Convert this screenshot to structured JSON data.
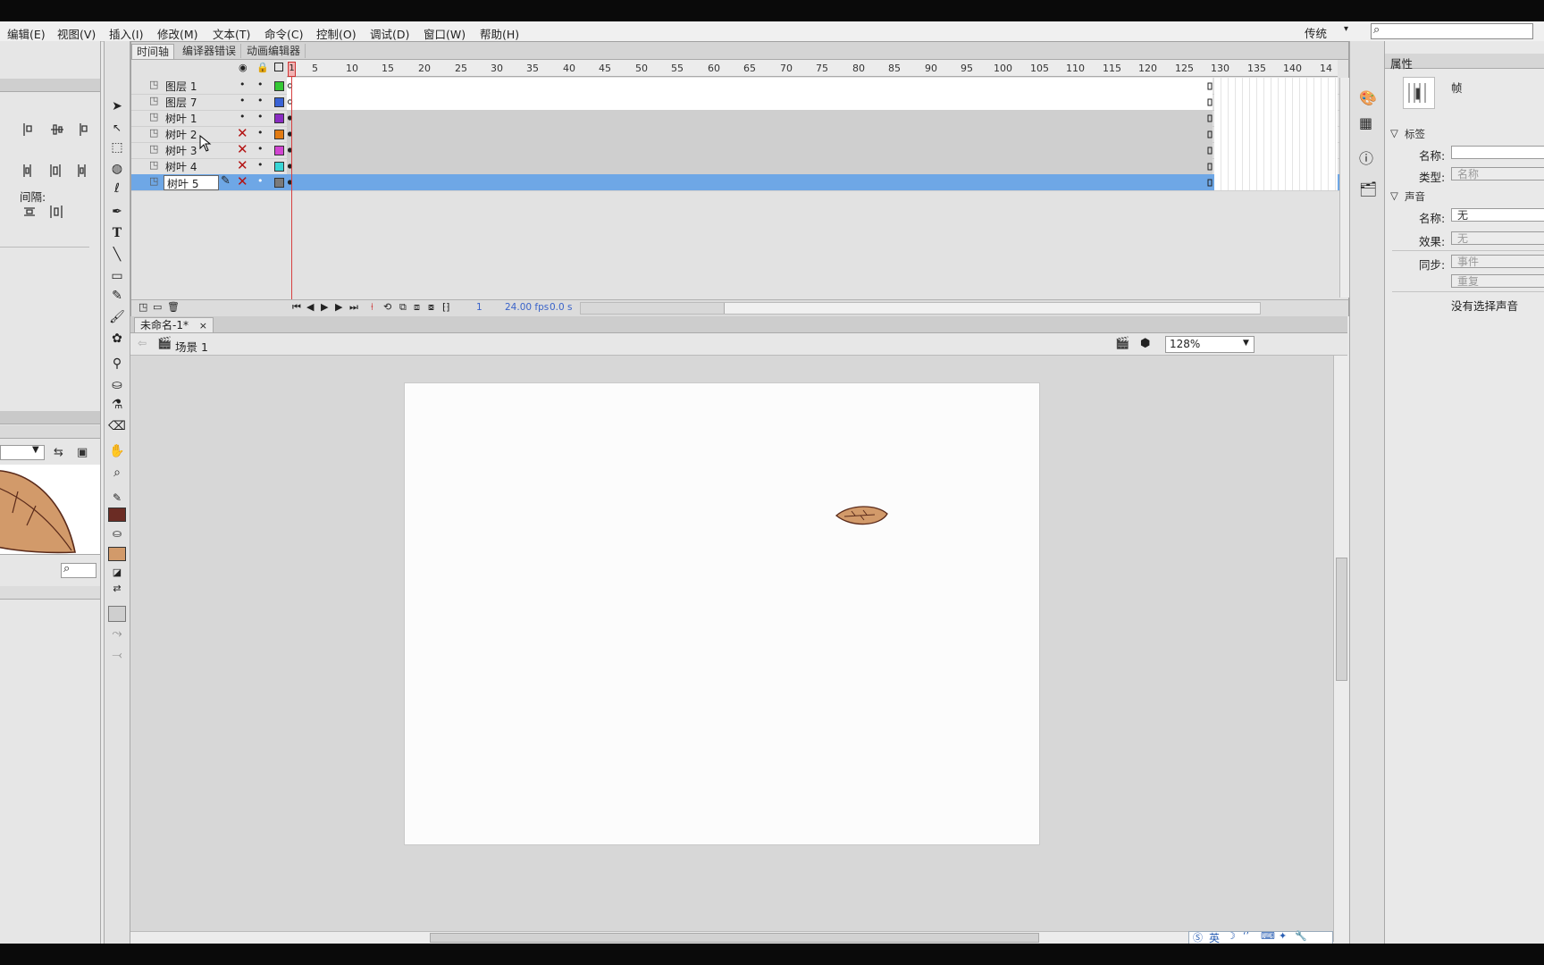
{
  "menu": [
    "编辑(E)",
    "视图(V)",
    "插入(I)",
    "修改(M)",
    "文本(T)",
    "命令(C)",
    "控制(O)",
    "调试(D)",
    "窗口(W)",
    "帮助(H)"
  ],
  "workspace": {
    "label": "传统",
    "caret": "▾"
  },
  "left_panel": {
    "spacing_label": "间隔:"
  },
  "timeline": {
    "tabs": [
      "时间轴",
      "编译器错误",
      "动画编辑器"
    ],
    "ruler": [
      "5",
      "10",
      "15",
      "20",
      "25",
      "30",
      "35",
      "40",
      "45",
      "50",
      "55",
      "60",
      "65",
      "70",
      "75",
      "80",
      "85",
      "90",
      "95",
      "100",
      "105",
      "110",
      "115",
      "120",
      "125",
      "130",
      "135",
      "140",
      "14"
    ],
    "playhead_frame": "1",
    "layers": [
      {
        "name": "图层 1",
        "color": "#35c935",
        "hidden": false,
        "selected": false
      },
      {
        "name": "图层 7",
        "color": "#3a63d6",
        "hidden": false,
        "selected": false
      },
      {
        "name": "树叶 1",
        "color": "#8a2cc2",
        "hidden": false,
        "selected": false
      },
      {
        "name": "树叶 2",
        "color": "#e27b12",
        "hidden": true,
        "selected": false
      },
      {
        "name": "树叶 3",
        "color": "#d145d1",
        "hidden": true,
        "selected": false
      },
      {
        "name": "树叶 4",
        "color": "#39d6d6",
        "hidden": true,
        "selected": false
      },
      {
        "name": "树叶 5",
        "color": "#7a7a7a",
        "hidden": true,
        "selected": true
      }
    ],
    "status": {
      "frame": "1",
      "fps": "24.00 fps",
      "time": "0.0 s"
    }
  },
  "document": {
    "tab": "未命名-1*",
    "close": "×",
    "scene": "场景 1",
    "zoom": "128%"
  },
  "properties": {
    "title": "属性",
    "type": "帧",
    "label_section": "标签",
    "name_label": "名称:",
    "name_value": "",
    "type_label": "类型:",
    "type_value": "名称",
    "sound_section": "声音",
    "sound_name_label": "名称:",
    "sound_name_value": "无",
    "effect_label": "效果:",
    "effect_value": "无",
    "sync_label": "同步:",
    "sync_value": "事件",
    "repeat_value": "重复",
    "no_sound": "没有选择声音"
  },
  "ime": {
    "lang": "英"
  },
  "colors": {
    "stroke": "#6b2c24",
    "fill": "#d29a6a",
    "selection": "#6ea7e6",
    "leaf": "#d29a6a"
  }
}
